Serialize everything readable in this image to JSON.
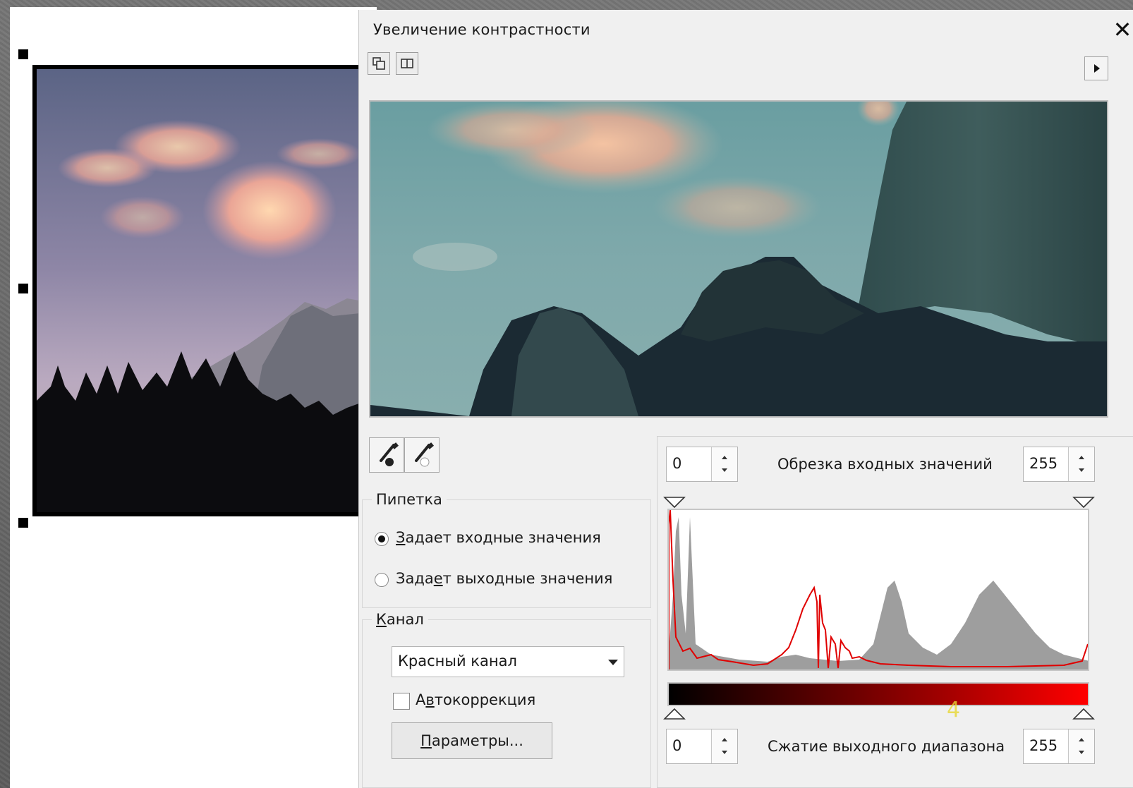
{
  "dialog": {
    "title": "Увеличение контрастности",
    "close_glyph": "✕"
  },
  "eyedropper": {
    "group_label": "Пипетка",
    "option_input": {
      "label_prefix": "",
      "label_underlined": "З",
      "label_rest": "адает входные значения",
      "checked": true
    },
    "option_output": {
      "label_prefix": "Зада",
      "label_underlined": "е",
      "label_rest": "т выходные значения",
      "checked": false
    }
  },
  "channel": {
    "group_label_underlined": "К",
    "group_label_rest": "анал",
    "selected": "Красный канал",
    "auto": {
      "label_prefix": "А",
      "label_underlined": "в",
      "label_rest": "токоррекция",
      "checked": false
    },
    "params_button": {
      "label_underlined": "П",
      "label_rest": "араметры..."
    }
  },
  "input_clip": {
    "label": "Обрезка входных значений",
    "low": "0",
    "high": "255"
  },
  "output_range": {
    "label": "Сжатие выходного диапазона",
    "low": "0",
    "high": "255"
  },
  "overlay_digit": "4",
  "colors": {
    "histogram_gray": "#9e9e9e",
    "histogram_red": "#e00000",
    "dialog_bg": "#f0f0f0"
  },
  "icons": {
    "tool_1": "split-preview-icon",
    "tool_2": "side-by-side-icon",
    "expand": "arrow-right-icon",
    "eyedropper_dark": "eyedropper-black-icon",
    "eyedropper_light": "eyedropper-white-icon"
  }
}
